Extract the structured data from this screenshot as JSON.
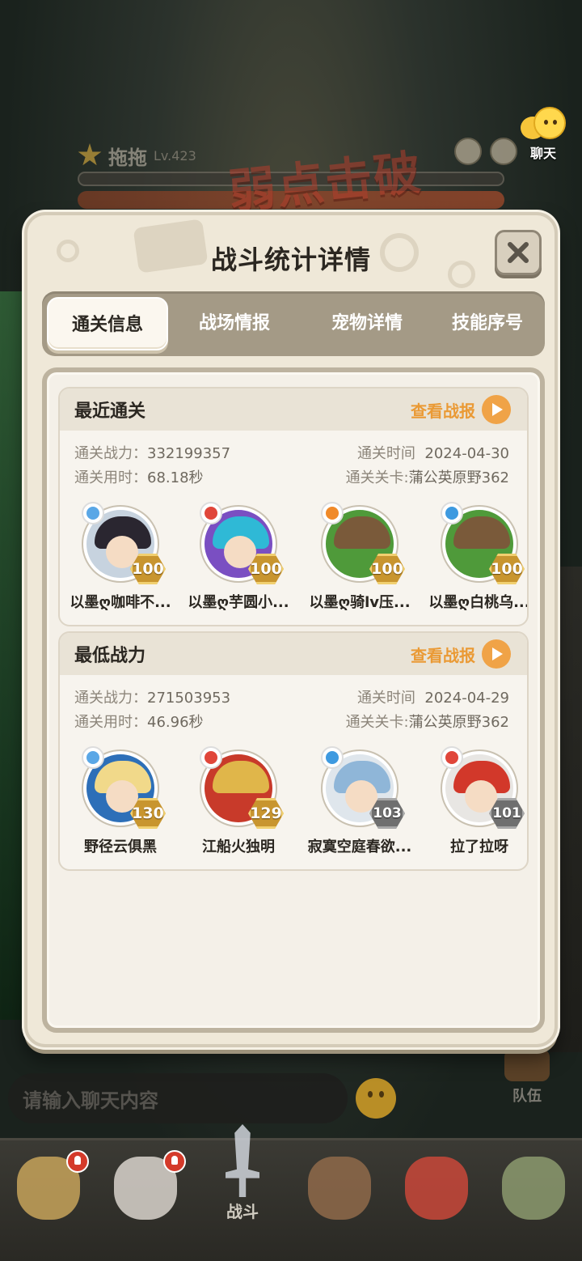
{
  "background": {
    "boss": {
      "name": "拖拖",
      "level": "Lv.423",
      "banner": "弱点击破"
    },
    "chat_button_label": "聊天",
    "chat_input_placeholder": "请输入聊天内容",
    "team_label": "队伍",
    "bottom_nav": {
      "items": [
        {
          "icon": "character-1-icon",
          "label": "",
          "badge": true
        },
        {
          "icon": "character-2-icon",
          "label": "",
          "badge": true
        },
        {
          "icon": "battle-sword-icon",
          "label": "战斗",
          "active": true
        },
        {
          "icon": "character-3-icon",
          "label": ""
        },
        {
          "icon": "character-4-icon",
          "label": ""
        },
        {
          "icon": "character-5-icon",
          "label": ""
        }
      ]
    }
  },
  "modal": {
    "title": "战斗统计详情",
    "tabs": [
      {
        "label": "通关信息",
        "active": true
      },
      {
        "label": "战场情报"
      },
      {
        "label": "宠物详情"
      },
      {
        "label": "技能序号"
      }
    ],
    "sections": [
      {
        "title": "最近通关",
        "report_label": "查看战报",
        "power_label": "通关战力：",
        "power_value": "332199357",
        "duration_label": "通关用时：",
        "duration_value": "68.18秒",
        "time_label": "通关时间",
        "time_value": "2024-04-30",
        "stage_label": "通关关卡:",
        "stage_value": "蒲公英原野362",
        "heroes": [
          {
            "name": "以墨ღ咖啡不...",
            "level": "100",
            "element": "ice"
          },
          {
            "name": "以墨ღ芋圆小...",
            "level": "100",
            "element": "fire"
          },
          {
            "name": "以墨ღ骑lv压...",
            "level": "100",
            "element": "fire-orange"
          },
          {
            "name": "以墨ღ白桃乌...",
            "level": "100",
            "element": "water"
          }
        ]
      },
      {
        "title": "最低战力",
        "report_label": "查看战报",
        "power_label": "通关战力：",
        "power_value": "271503953",
        "duration_label": "通关用时：",
        "duration_value": "46.96秒",
        "time_label": "通关时间",
        "time_value": "2024-04-29",
        "stage_label": "通关关卡:",
        "stage_value": "蒲公英原野362",
        "heroes": [
          {
            "name": "野径云俱黑",
            "level": "130",
            "element": "ice"
          },
          {
            "name": "江船火独明",
            "level": "129",
            "element": "fire"
          },
          {
            "name": "寂寞空庭春欲...",
            "level": "103",
            "element": "water"
          },
          {
            "name": "拉了拉呀",
            "level": "101",
            "element": "fire"
          }
        ]
      }
    ]
  },
  "colors": {
    "accent_orange": "#ea9a35",
    "level_gold": "#c8952f",
    "level_grey": "#6f6f6f",
    "panel": "#efe8d8"
  }
}
